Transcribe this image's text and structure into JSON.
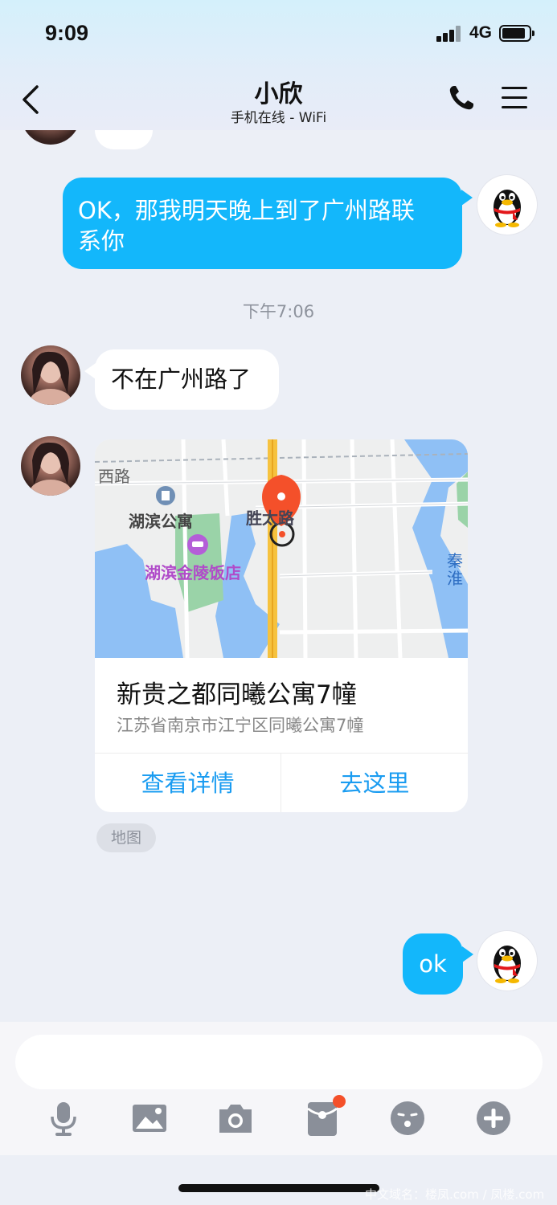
{
  "status_bar": {
    "time": "9:09",
    "network": "4G"
  },
  "header": {
    "title": "小欣",
    "subtitle": "手机在线 - WiFi"
  },
  "messages": [
    {
      "id": "m1",
      "direction": "out",
      "text": "OK，那我明天晚上到了广州路联\n系你"
    },
    {
      "id": "m2",
      "direction": "in",
      "text": "不在广州路了"
    },
    {
      "id": "m4",
      "direction": "out",
      "text": "ok"
    }
  ],
  "timestamp": "下午7:06",
  "location_card": {
    "name": "新贵之都同曦公寓7幢",
    "address": "江苏省南京市江宁区同曦公寓7幢",
    "view_details_label": "查看详情",
    "navigate_label": "去这里",
    "tag": "地图",
    "map_labels": {
      "road": "西路",
      "poi1": "湖滨公寓",
      "poi2": "湖滨金陵饭店",
      "poi3": "胜太路",
      "poi4": "秦淮"
    }
  },
  "toolbar": {
    "items": [
      "microphone-icon",
      "image-icon",
      "camera-icon",
      "red-packet-icon",
      "emoji-icon",
      "plus-icon"
    ],
    "red_packet_has_dot": true
  },
  "watermark": "中文域名：楼凤.com / 凤楼.com",
  "colors": {
    "accent": "#13b7fb",
    "link": "#1a9cf1",
    "pin": "#f4502a"
  }
}
